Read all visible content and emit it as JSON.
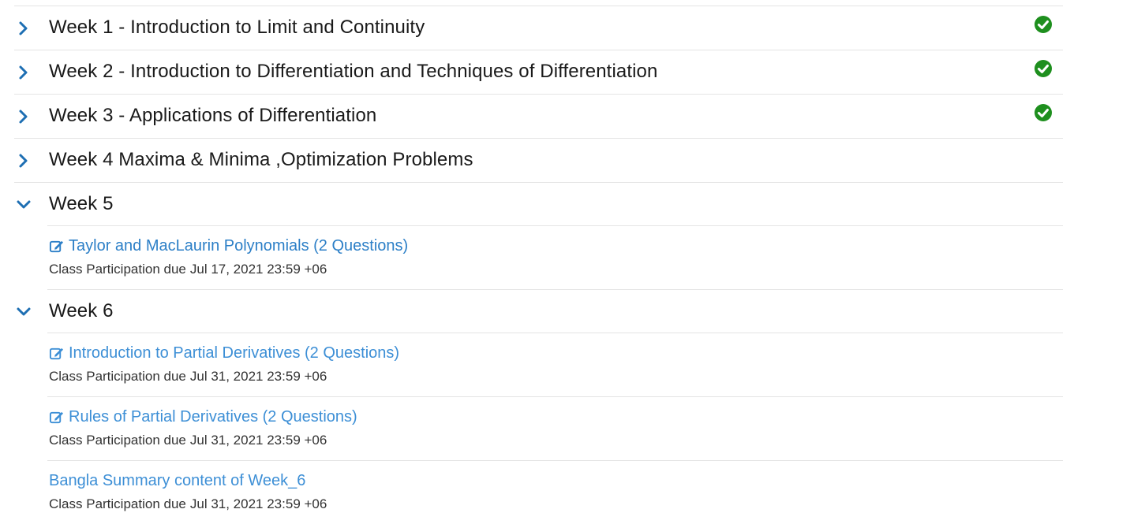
{
  "colors": {
    "accent_link": "#2c7fc7",
    "chevron": "#1e6fb3",
    "check": "#1e8f1e",
    "divider": "#e4e4e4"
  },
  "weeks": [
    {
      "title": "Week 1 - Introduction to Limit and Continuity",
      "completed": true,
      "icon": "chevron-right-icon"
    },
    {
      "title": "Week 2 - Introduction to Differentiation and Techniques of Differentiation",
      "completed": true,
      "icon": "chevron-right-icon"
    },
    {
      "title": "Week 3 - Applications of Differentiation",
      "completed": true,
      "icon": "chevron-right-icon"
    },
    {
      "title": "Week 4 Maxima & Minima ,Optimization Problems",
      "completed": false,
      "icon": "chevron-right-icon"
    },
    {
      "title": "Week 5",
      "expanded": true,
      "icon": "chevron-down-icon",
      "units": [
        {
          "title": "Taylor and MacLaurin Polynomials (2 Questions)",
          "has_icon": true,
          "due_label": "Class Participation due",
          "due_date": "Jul 17, 2021 23:59 +06"
        }
      ]
    },
    {
      "title": "Week 6",
      "expanded": true,
      "icon": "chevron-down-icon",
      "units": [
        {
          "title": "Introduction to Partial Derivatives (2 Questions)",
          "has_icon": true,
          "due_label": "Class Participation due",
          "due_date": "Jul 31, 2021 23:59 +06"
        },
        {
          "title": "Rules of Partial Derivatives (2 Questions)",
          "has_icon": true,
          "due_label": "Class Participation due",
          "due_date": "Jul 31, 2021 23:59 +06"
        },
        {
          "title": "Bangla Summary content of Week_6",
          "has_icon": false,
          "due_label": "Class Participation due",
          "due_date": "Jul 31, 2021 23:59 +06"
        }
      ]
    }
  ]
}
